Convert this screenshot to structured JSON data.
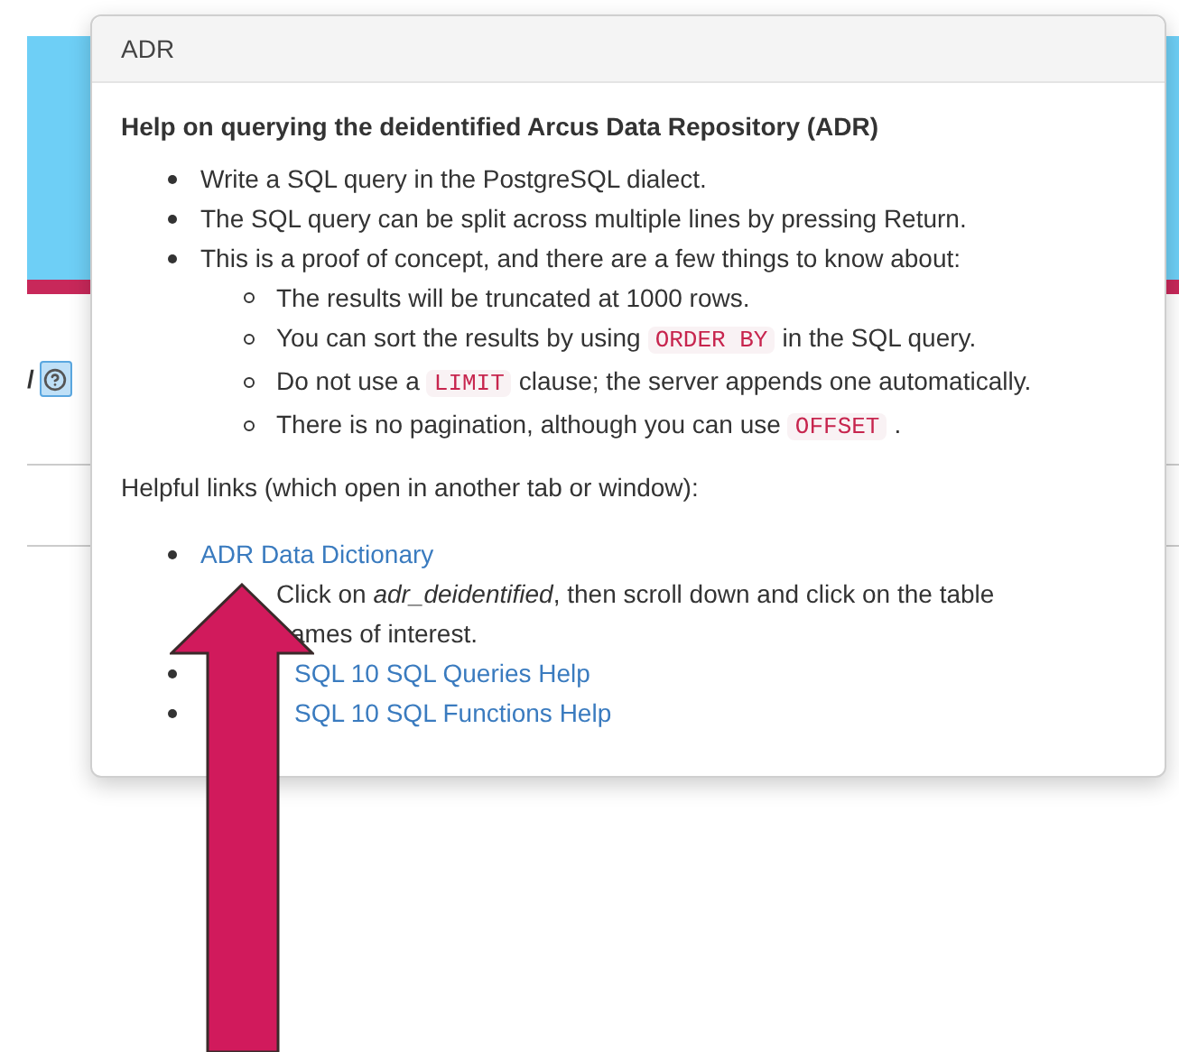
{
  "page": {
    "label_fragment": "/"
  },
  "popover": {
    "title": "ADR",
    "heading": "Help on querying the deidentified Arcus Data Repository (ADR)",
    "items": [
      {
        "parts": [
          {
            "kind": "text",
            "text": "Write a SQL query in the PostgreSQL dialect."
          }
        ]
      },
      {
        "parts": [
          {
            "kind": "text",
            "text": "The SQL query can be split across multiple lines by pressing Return."
          }
        ]
      },
      {
        "parts": [
          {
            "kind": "text",
            "text": "This is a proof of concept, and there are a few things to know about:"
          }
        ],
        "children": [
          {
            "parts": [
              {
                "kind": "text",
                "text": "The results will be truncated at 1000 rows."
              }
            ]
          },
          {
            "parts": [
              {
                "kind": "text",
                "text": "You can sort the results by using"
              },
              {
                "kind": "code",
                "text": "ORDER BY"
              },
              {
                "kind": "text",
                "text": "in the SQL query."
              }
            ]
          },
          {
            "parts": [
              {
                "kind": "text",
                "text": "Do not use a"
              },
              {
                "kind": "code",
                "text": "LIMIT"
              },
              {
                "kind": "text",
                "text": "clause; the server appends one automatically."
              }
            ]
          },
          {
            "parts": [
              {
                "kind": "text",
                "text": "There is no pagination, although you can use"
              },
              {
                "kind": "code",
                "text": "OFFSET"
              },
              {
                "kind": "text",
                "text": "."
              }
            ]
          }
        ]
      }
    ],
    "links_intro": "Helpful links (which open in another tab or window):",
    "links": [
      {
        "label": "ADR Data Dictionary",
        "note": [
          "Click on *adr_deidentified*, then scroll down and click on the table",
          "ames of interest."
        ]
      },
      {
        "label_end": "SQL 10 SQL Queries Help"
      },
      {
        "label_end": "SQL 10 SQL Functions Help"
      }
    ]
  }
}
